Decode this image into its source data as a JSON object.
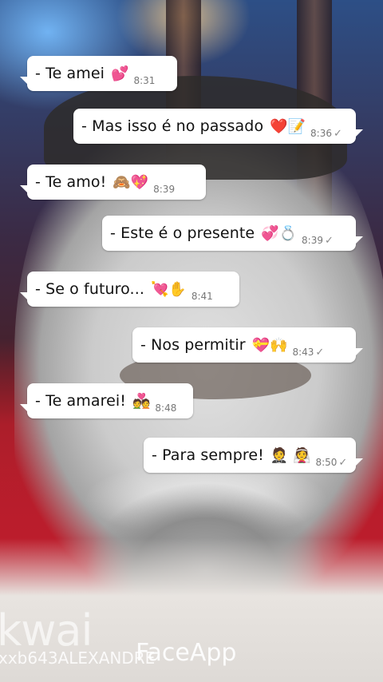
{
  "messages": [
    {
      "text": "- Te amei",
      "emoji": "💕",
      "time": "8:31",
      "side": "left",
      "read": false
    },
    {
      "text": "- Mas isso é no passado",
      "emoji": "❤️📝",
      "time": "8:36",
      "side": "right",
      "read": true
    },
    {
      "text": "- Te amo!",
      "emoji": "🙈💖",
      "time": "8:39",
      "side": "left",
      "read": false
    },
    {
      "text": "- Este é o presente",
      "emoji": "💞💍",
      "time": "8:39",
      "side": "right",
      "read": true
    },
    {
      "text": "- Se o futuro...",
      "emoji": "💘✋",
      "time": "8:41",
      "side": "left",
      "read": false
    },
    {
      "text": "- Nos permitir",
      "emoji": "💝🙌",
      "time": "8:43",
      "side": "right",
      "read": true
    },
    {
      "text": "- Te amarei!",
      "emoji": "💑",
      "time": "8:48",
      "side": "left",
      "read": false
    },
    {
      "text": "- Para sempre!",
      "emoji": "🤵 👰",
      "time": "8:50",
      "side": "right",
      "read": true
    }
  ],
  "checkmark": "✓",
  "watermarks": {
    "kwai": "kwai",
    "username": "xxb643ALEXANDRE",
    "faceapp": "FaceApp"
  }
}
